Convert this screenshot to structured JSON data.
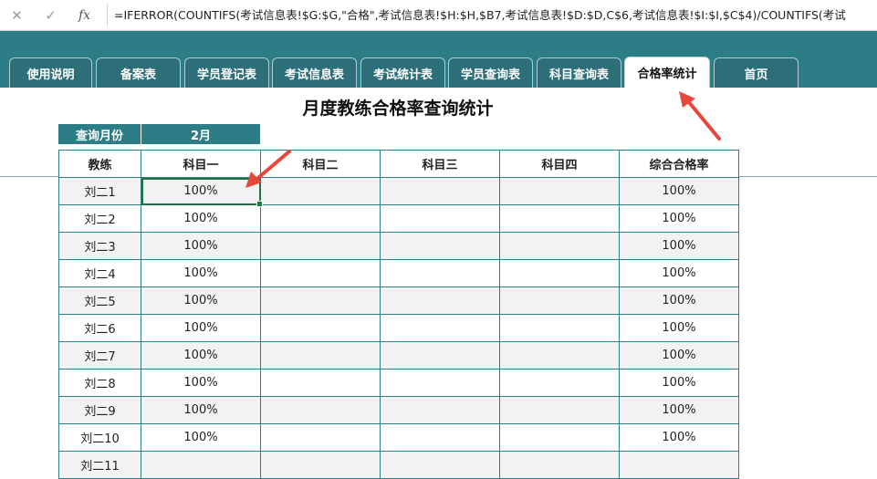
{
  "formula_bar": {
    "cancel_icon": "✕",
    "confirm_icon": "✓",
    "fx_label": "fx",
    "formula": "=IFERROR(COUNTIFS(考试信息表!$G:$G,\"合格\",考试信息表!$H:$H,$B7,考试信息表!$D:$D,C$6,考试信息表!$I:$I,$C$4)/COUNTIFS(考试"
  },
  "tabs": [
    {
      "label": "使用说明"
    },
    {
      "label": "备案表"
    },
    {
      "label": "学员登记表"
    },
    {
      "label": "考试信息表"
    },
    {
      "label": "考试统计表"
    },
    {
      "label": "学员查询表"
    },
    {
      "label": "科目查询表"
    },
    {
      "label": "合格率统计",
      "active": true
    },
    {
      "label": "首页"
    }
  ],
  "sheet": {
    "title": "月度教练合格率查询统计",
    "month_label": "查询月份",
    "month_value": "2月",
    "headers": [
      "教练",
      "科目一",
      "科目二",
      "科目三",
      "科目四",
      "综合合格率"
    ],
    "rows": [
      [
        "刘二1",
        "100%",
        "",
        "",
        "",
        "100%"
      ],
      [
        "刘二2",
        "100%",
        "",
        "",
        "",
        "100%"
      ],
      [
        "刘二3",
        "100%",
        "",
        "",
        "",
        "100%"
      ],
      [
        "刘二4",
        "100%",
        "",
        "",
        "",
        "100%"
      ],
      [
        "刘二5",
        "100%",
        "",
        "",
        "",
        "100%"
      ],
      [
        "刘二6",
        "100%",
        "",
        "",
        "",
        "100%"
      ],
      [
        "刘二7",
        "100%",
        "",
        "",
        "",
        "100%"
      ],
      [
        "刘二8",
        "100%",
        "",
        "",
        "",
        "100%"
      ],
      [
        "刘二9",
        "100%",
        "",
        "",
        "",
        "100%"
      ],
      [
        "刘二10",
        "100%",
        "",
        "",
        "",
        "100%"
      ],
      [
        "刘二11",
        "",
        "",
        "",
        "",
        ""
      ]
    ]
  },
  "colors": {
    "accent": "#2d7d87",
    "annotation": "#e8473c",
    "selection": "#217346"
  }
}
